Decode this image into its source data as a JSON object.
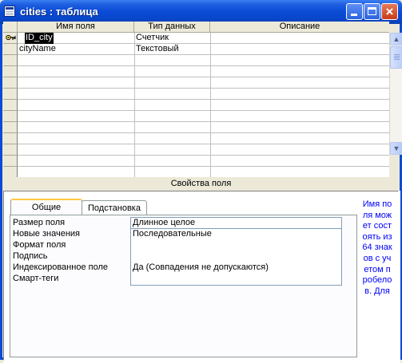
{
  "window": {
    "title": "cities : таблица"
  },
  "grid": {
    "headers": {
      "field_name": "Имя поля",
      "data_type": "Тип данных",
      "description": "Описание"
    },
    "rows": [
      {
        "field_name": "ID_city",
        "data_type": "Счетчик",
        "description": ""
      },
      {
        "field_name": "cityName",
        "data_type": "Текстовый",
        "description": ""
      }
    ],
    "selected_row": 0,
    "primary_key_row": 0
  },
  "properties": {
    "title": "Свойства поля",
    "tabs": [
      {
        "label": "Общие",
        "active": true
      },
      {
        "label": "Подстановка",
        "active": false
      }
    ],
    "rows": [
      {
        "name": "Размер поля",
        "value": "Длинное целое"
      },
      {
        "name": "Новые значения",
        "value": "Последовательные"
      },
      {
        "name": "Формат поля",
        "value": ""
      },
      {
        "name": "Подпись",
        "value": ""
      },
      {
        "name": "Индексированное поле",
        "value": "Да (Совпадения не допускаются)"
      },
      {
        "name": "Смарт-теги",
        "value": ""
      }
    ],
    "help_text": "Имя поля может состоять из 64 знаков с учетом пробелов. Для"
  },
  "colors": {
    "titlebar": "#0a4ad6",
    "help_text": "#0000ff",
    "active_tab_accent": "#ffc83c"
  }
}
